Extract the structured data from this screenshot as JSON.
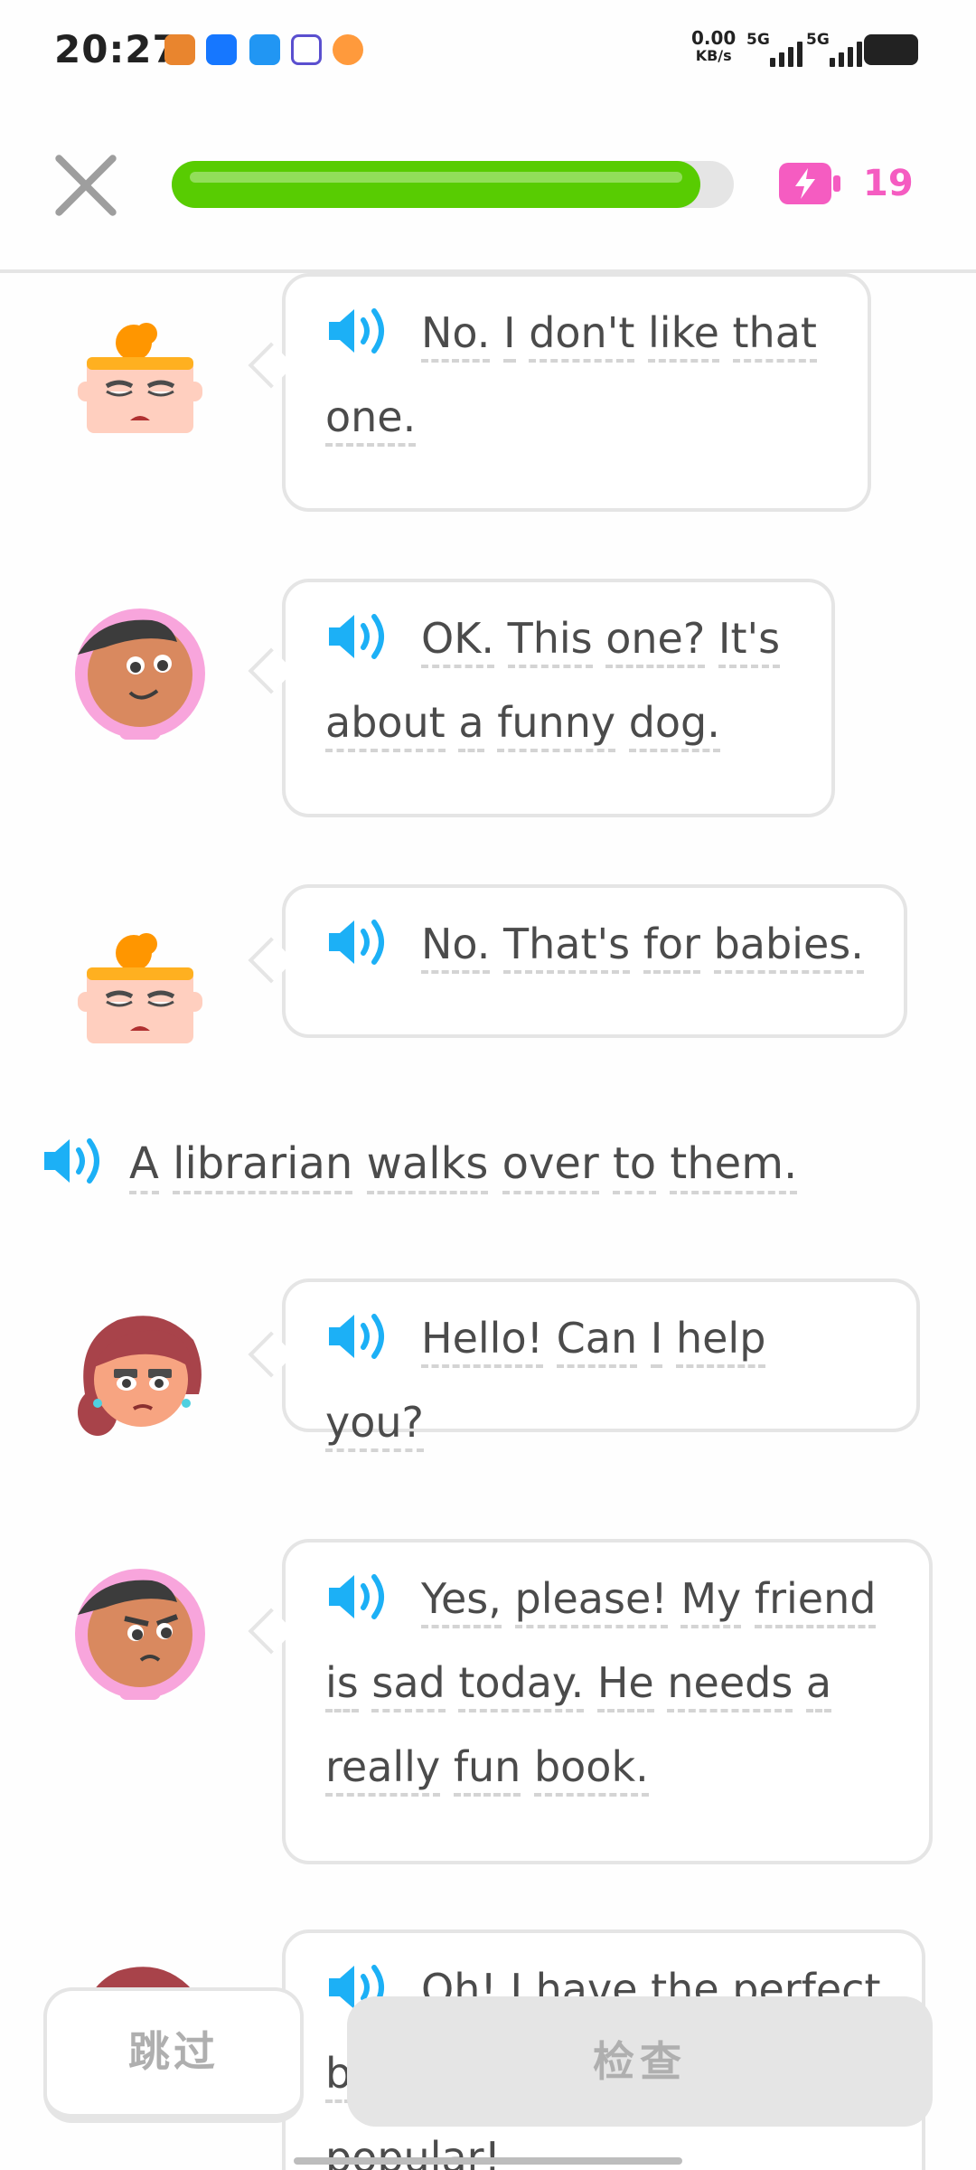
{
  "status_bar": {
    "time": "20:27",
    "net_speed_value": "0.00",
    "net_speed_unit": "KB/s",
    "signal_1": "5G",
    "signal_2": "5G"
  },
  "header": {
    "progress_fraction": 0.94,
    "energy_count": "19"
  },
  "colors": {
    "progress": "#58cc02",
    "energy": "#f55cc1",
    "speaker": "#1cb0f6",
    "border": "#e5e5e5"
  },
  "conversation": {
    "lines": [
      {
        "speaker": "bea",
        "words": [
          "No.",
          "I",
          "don't",
          "like",
          "that",
          "one."
        ]
      },
      {
        "speaker": "lily",
        "words": [
          "OK.",
          "This",
          "one?",
          "It's",
          "about",
          "a",
          "funny",
          "dog."
        ]
      },
      {
        "speaker": "bea",
        "words": [
          "No.",
          "That's",
          "for",
          "babies."
        ]
      },
      {
        "speaker": "librarian",
        "words": [
          "Hello!",
          "Can",
          "I",
          "help",
          "you?"
        ]
      },
      {
        "speaker": "lily",
        "words": [
          "Yes,",
          "please!",
          "My",
          "friend",
          "is",
          "sad",
          "today.",
          "He",
          "needs",
          "a",
          "really",
          "fun",
          "book."
        ]
      },
      {
        "speaker": "librarian",
        "words": [
          "Oh!",
          "I",
          "have",
          "the",
          "perfect",
          "b",
          "popular!"
        ]
      }
    ],
    "narration": [
      "A",
      "librarian",
      "walks",
      "over",
      "to",
      "them."
    ]
  },
  "buttons": {
    "skip": "跳过",
    "check": "检查"
  }
}
